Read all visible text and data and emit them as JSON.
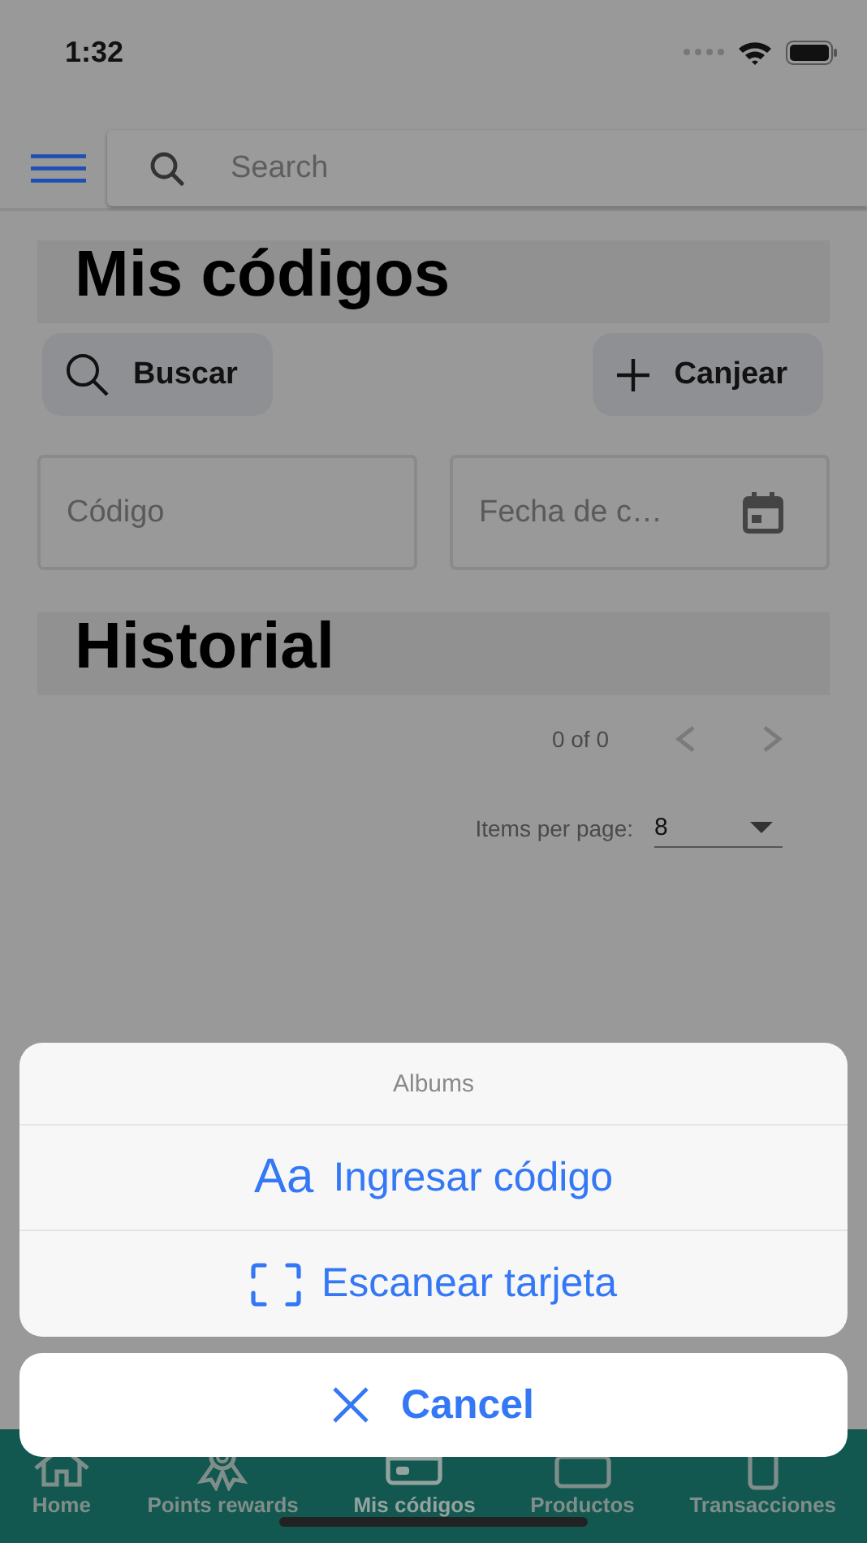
{
  "status_bar": {
    "time": "1:32"
  },
  "search": {
    "placeholder": "Search"
  },
  "title": "Mis códigos",
  "buttons": [
    {
      "label": "Buscar",
      "kind": "search"
    },
    {
      "label": "Canjear",
      "kind": "add"
    }
  ],
  "fields": [
    {
      "placeholder": "Código",
      "kind": "text"
    },
    {
      "placeholder": "Fecha de c…",
      "kind": "date"
    }
  ],
  "history_title": "Historial",
  "paginator": {
    "range": "0 of 0",
    "items_per_page_label": "Items per page:",
    "page_size": "8"
  },
  "action_sheet": {
    "title": "Albums",
    "actions": [
      {
        "label": "Ingresar código",
        "kind": "text",
        "icon": "Aa"
      },
      {
        "label": "Escanear tarjeta",
        "kind": "scan"
      }
    ],
    "cancel": "Cancel"
  },
  "tabs": [
    {
      "label": "Home",
      "kind": "home",
      "selected": false
    },
    {
      "label": "Points rewards",
      "kind": "award",
      "selected": false
    },
    {
      "label": "Mis códigos",
      "kind": "card",
      "selected": true
    },
    {
      "label": "Productos",
      "kind": "bag",
      "selected": false
    },
    {
      "label": "Transacciones",
      "kind": "phone",
      "selected": false
    }
  ]
}
